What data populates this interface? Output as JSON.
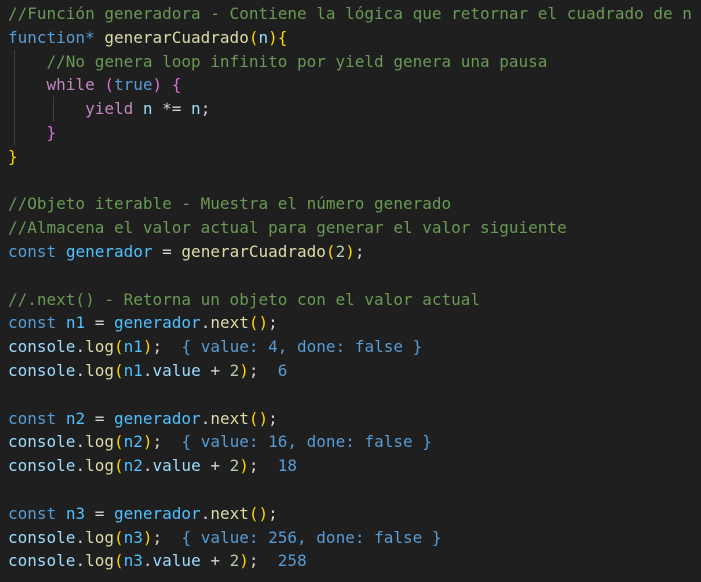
{
  "editor": {
    "lines": [
      [
        {
          "t": "//Función generadora - Contiene la lógica que retornar el cuadrado de n",
          "c": "comment"
        }
      ],
      [
        {
          "t": "function",
          "c": "keyword"
        },
        {
          "t": "* ",
          "c": "keyword"
        },
        {
          "t": "generarCuadrado",
          "c": "func"
        },
        {
          "t": "(",
          "c": "brace"
        },
        {
          "t": "n",
          "c": "var"
        },
        {
          "t": ")",
          "c": "brace"
        },
        {
          "t": "{",
          "c": "brace"
        }
      ],
      [
        {
          "t": "    ",
          "c": "op"
        },
        {
          "t": "//No genera loop infinito por yield genera una pausa",
          "c": "comment"
        }
      ],
      [
        {
          "t": "    ",
          "c": "op"
        },
        {
          "t": "while",
          "c": "control"
        },
        {
          "t": " ",
          "c": "op"
        },
        {
          "t": "(",
          "c": "paren2"
        },
        {
          "t": "true",
          "c": "keyword"
        },
        {
          "t": ")",
          "c": "paren2"
        },
        {
          "t": " ",
          "c": "op"
        },
        {
          "t": "{",
          "c": "paren2"
        }
      ],
      [
        {
          "t": "        ",
          "c": "op"
        },
        {
          "t": "yield",
          "c": "control"
        },
        {
          "t": " ",
          "c": "op"
        },
        {
          "t": "n",
          "c": "var"
        },
        {
          "t": " *= ",
          "c": "op"
        },
        {
          "t": "n",
          "c": "var"
        },
        {
          "t": ";",
          "c": "op"
        }
      ],
      [
        {
          "t": "    ",
          "c": "op"
        },
        {
          "t": "}",
          "c": "paren2"
        }
      ],
      [
        {
          "t": "}",
          "c": "brace"
        }
      ],
      [],
      [
        {
          "t": "//Objeto iterable - Muestra el número generado",
          "c": "comment"
        }
      ],
      [
        {
          "t": "//Almacena el valor actual para generar el valor siguiente",
          "c": "comment"
        }
      ],
      [
        {
          "t": "const",
          "c": "keyword"
        },
        {
          "t": " ",
          "c": "op"
        },
        {
          "t": "generador",
          "c": "const"
        },
        {
          "t": " = ",
          "c": "op"
        },
        {
          "t": "generarCuadrado",
          "c": "func"
        },
        {
          "t": "(",
          "c": "brace"
        },
        {
          "t": "2",
          "c": "num"
        },
        {
          "t": ")",
          "c": "brace"
        },
        {
          "t": ";",
          "c": "op"
        }
      ],
      [],
      [
        {
          "t": "//.next() - Retorna un objeto con el valor actual",
          "c": "comment"
        }
      ],
      [
        {
          "t": "const",
          "c": "keyword"
        },
        {
          "t": " ",
          "c": "op"
        },
        {
          "t": "n1",
          "c": "const"
        },
        {
          "t": " = ",
          "c": "op"
        },
        {
          "t": "generador",
          "c": "const"
        },
        {
          "t": ".",
          "c": "op"
        },
        {
          "t": "next",
          "c": "func"
        },
        {
          "t": "()",
          "c": "brace"
        },
        {
          "t": ";",
          "c": "op"
        }
      ],
      [
        {
          "t": "console",
          "c": "var"
        },
        {
          "t": ".",
          "c": "op"
        },
        {
          "t": "log",
          "c": "func"
        },
        {
          "t": "(",
          "c": "brace"
        },
        {
          "t": "n1",
          "c": "const"
        },
        {
          "t": ")",
          "c": "brace"
        },
        {
          "t": ";  ",
          "c": "op"
        },
        {
          "t": "{ value: 4, done: false }",
          "c": "out"
        }
      ],
      [
        {
          "t": "console",
          "c": "var"
        },
        {
          "t": ".",
          "c": "op"
        },
        {
          "t": "log",
          "c": "func"
        },
        {
          "t": "(",
          "c": "brace"
        },
        {
          "t": "n1",
          "c": "const"
        },
        {
          "t": ".",
          "c": "op"
        },
        {
          "t": "value",
          "c": "var"
        },
        {
          "t": " + ",
          "c": "op"
        },
        {
          "t": "2",
          "c": "num"
        },
        {
          "t": ")",
          "c": "brace"
        },
        {
          "t": ";  ",
          "c": "op"
        },
        {
          "t": "6",
          "c": "out"
        }
      ],
      [],
      [
        {
          "t": "const",
          "c": "keyword"
        },
        {
          "t": " ",
          "c": "op"
        },
        {
          "t": "n2",
          "c": "const"
        },
        {
          "t": " = ",
          "c": "op"
        },
        {
          "t": "generador",
          "c": "const"
        },
        {
          "t": ".",
          "c": "op"
        },
        {
          "t": "next",
          "c": "func"
        },
        {
          "t": "()",
          "c": "brace"
        },
        {
          "t": ";",
          "c": "op"
        }
      ],
      [
        {
          "t": "console",
          "c": "var"
        },
        {
          "t": ".",
          "c": "op"
        },
        {
          "t": "log",
          "c": "func"
        },
        {
          "t": "(",
          "c": "brace"
        },
        {
          "t": "n2",
          "c": "const"
        },
        {
          "t": ")",
          "c": "brace"
        },
        {
          "t": ";  ",
          "c": "op"
        },
        {
          "t": "{ value: 16, done: false }",
          "c": "out"
        }
      ],
      [
        {
          "t": "console",
          "c": "var"
        },
        {
          "t": ".",
          "c": "op"
        },
        {
          "t": "log",
          "c": "func"
        },
        {
          "t": "(",
          "c": "brace"
        },
        {
          "t": "n2",
          "c": "const"
        },
        {
          "t": ".",
          "c": "op"
        },
        {
          "t": "value",
          "c": "var"
        },
        {
          "t": " + ",
          "c": "op"
        },
        {
          "t": "2",
          "c": "num"
        },
        {
          "t": ")",
          "c": "brace"
        },
        {
          "t": ";  ",
          "c": "op"
        },
        {
          "t": "18",
          "c": "out"
        }
      ],
      [],
      [
        {
          "t": "const",
          "c": "keyword"
        },
        {
          "t": " ",
          "c": "op"
        },
        {
          "t": "n3",
          "c": "const"
        },
        {
          "t": " = ",
          "c": "op"
        },
        {
          "t": "generador",
          "c": "const"
        },
        {
          "t": ".",
          "c": "op"
        },
        {
          "t": "next",
          "c": "func"
        },
        {
          "t": "()",
          "c": "brace"
        },
        {
          "t": ";",
          "c": "op"
        }
      ],
      [
        {
          "t": "console",
          "c": "var"
        },
        {
          "t": ".",
          "c": "op"
        },
        {
          "t": "log",
          "c": "func"
        },
        {
          "t": "(",
          "c": "brace"
        },
        {
          "t": "n3",
          "c": "const"
        },
        {
          "t": ")",
          "c": "brace"
        },
        {
          "t": ";  ",
          "c": "op"
        },
        {
          "t": "{ value: 256, done: false }",
          "c": "out"
        }
      ],
      [
        {
          "t": "console",
          "c": "var"
        },
        {
          "t": ".",
          "c": "op"
        },
        {
          "t": "log",
          "c": "func"
        },
        {
          "t": "(",
          "c": "brace"
        },
        {
          "t": "n3",
          "c": "const"
        },
        {
          "t": ".",
          "c": "op"
        },
        {
          "t": "value",
          "c": "var"
        },
        {
          "t": " + ",
          "c": "op"
        },
        {
          "t": "2",
          "c": "num"
        },
        {
          "t": ")",
          "c": "brace"
        },
        {
          "t": ";  ",
          "c": "op"
        },
        {
          "t": "258",
          "c": "out"
        }
      ]
    ],
    "guides": [
      [],
      [],
      [
        1
      ],
      [
        1
      ],
      [
        1,
        2
      ],
      [
        1
      ],
      [],
      [],
      [],
      [],
      [],
      [],
      [],
      [],
      [],
      [],
      [],
      [],
      [],
      [],
      [],
      [],
      [],
      []
    ]
  },
  "colors": {
    "background": "#1f1f1f",
    "comment": "#6a9955",
    "keyword": "#569cd6",
    "control": "#c586c0",
    "function": "#dcdcaa",
    "variable": "#9cdcfe",
    "constant": "#4fc1ff",
    "number": "#b5cea8",
    "bracket_1": "#ffd700",
    "bracket_2": "#da70d6"
  }
}
